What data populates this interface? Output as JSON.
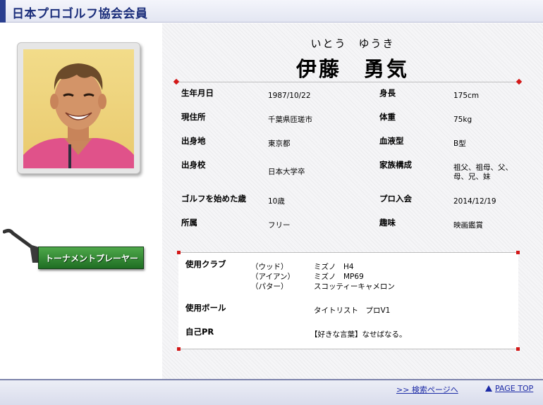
{
  "header": {
    "title": "日本プロゴルフ協会会員"
  },
  "profile": {
    "name_kana": "いとう　ゆうき",
    "name": "伊藤　勇気",
    "fields": [
      {
        "label": "生年月日",
        "value": "1987/10/22"
      },
      {
        "label": "身長",
        "value": "175cm"
      },
      {
        "label": "現住所",
        "value": "千葉県匝瑳市"
      },
      {
        "label": "体重",
        "value": "75kg"
      },
      {
        "label": "出身地",
        "value": "東京都"
      },
      {
        "label": "血液型",
        "value": "B型"
      },
      {
        "label": "出身校",
        "value": "日本大学卒"
      },
      {
        "label": "家族構成",
        "value_line1": "祖父、祖母、父、",
        "value_line2": "母、兄、妹"
      },
      {
        "label": "ゴルフを始めた歳",
        "value": "10歳"
      },
      {
        "label": "プロ入会",
        "value": "2014/12/19"
      },
      {
        "label": "所属",
        "value": "フリー"
      },
      {
        "label": "趣味",
        "value": "映画鑑賞"
      }
    ]
  },
  "equipment": {
    "club_label": "使用クラブ",
    "clubs": [
      {
        "type": "（ウッド）",
        "model": "ミズノ　H4"
      },
      {
        "type": "（アイアン）",
        "model": "ミズノ　MP69"
      },
      {
        "type": "（パター）",
        "model": "スコッティーキャメロン"
      }
    ],
    "ball_label": "使用ボール",
    "ball": "タイトリスト　プロV1",
    "pr_label": "自己PR",
    "pr": "【好きな言葉】なせばなる。"
  },
  "badge": {
    "label": "トーナメントプレーヤー"
  },
  "footer": {
    "search_link": ">> 検索ページへ",
    "top_link": "PAGE TOP"
  },
  "colors": {
    "header_text": "#1a2d7a",
    "badge_green": "#2e8b2f",
    "accent_red": "#d31818",
    "link_blue": "#1c2aa6"
  }
}
